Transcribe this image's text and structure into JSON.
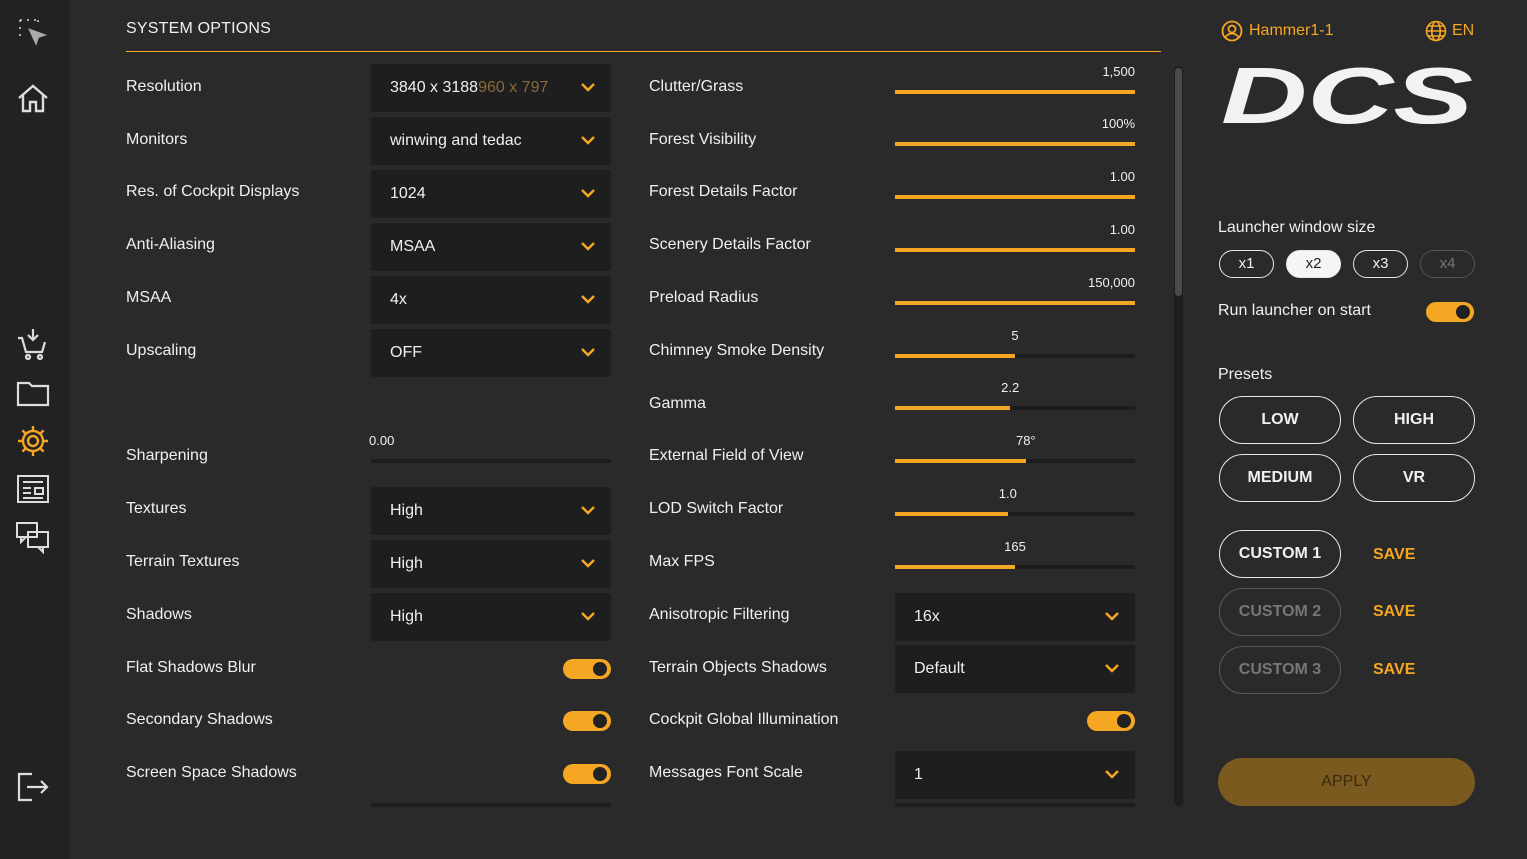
{
  "colors": {
    "accent": "#f5a623",
    "background": "#2a2a2a",
    "rail": "#222222",
    "field": "#1e1e1e"
  },
  "rail_icons": [
    "select-icon",
    "home-icon",
    "download-cart-icon",
    "folder-icon",
    "gear-icon",
    "news-icon",
    "chat-icon",
    "logout-icon"
  ],
  "header": {
    "title": "SYSTEM OPTIONS"
  },
  "left": {
    "resolution": {
      "label": "Resolution",
      "value": "3840 x 3188",
      "ghost": "960 x 797"
    },
    "monitors": {
      "label": "Monitors",
      "value": "winwing and tedac"
    },
    "cockpit_res": {
      "label": "Res. of Cockpit Displays",
      "value": "1024"
    },
    "anti_aliasing": {
      "label": "Anti-Aliasing",
      "value": "MSAA"
    },
    "msaa": {
      "label": "MSAA",
      "value": "4x"
    },
    "upscaling": {
      "label": "Upscaling",
      "value": "OFF"
    },
    "sharpening": {
      "label": "Sharpening",
      "value": "0.00",
      "fraction": 0
    },
    "textures": {
      "label": "Textures",
      "value": "High"
    },
    "terrain_textures": {
      "label": "Terrain Textures",
      "value": "High"
    },
    "shadows": {
      "label": "Shadows",
      "value": "High"
    },
    "flat_shadows_blur": {
      "label": "Flat Shadows Blur",
      "on": true
    },
    "secondary_shadows": {
      "label": "Secondary Shadows",
      "on": true
    },
    "screen_space_shadows": {
      "label": "Screen Space Shadows",
      "on": true
    }
  },
  "right": {
    "clutter": {
      "label": "Clutter/Grass",
      "value": "1,500",
      "fraction": 1.0
    },
    "forest_visibility": {
      "label": "Forest Visibility",
      "value": "100%",
      "fraction": 1.0
    },
    "forest_details": {
      "label": "Forest Details Factor",
      "value": "1.00",
      "fraction": 1.0
    },
    "scenery_details": {
      "label": "Scenery Details Factor",
      "value": "1.00",
      "fraction": 1.0
    },
    "preload_radius": {
      "label": "Preload Radius",
      "value": "150,000",
      "fraction": 1.0
    },
    "chimney_smoke": {
      "label": "Chimney Smoke Density",
      "value": "5",
      "fraction": 0.5
    },
    "gamma": {
      "label": "Gamma",
      "value": "2.2",
      "fraction": 0.48
    },
    "external_fov": {
      "label": "External Field of View",
      "value": "78°",
      "fraction": 0.545
    },
    "lod_switch": {
      "label": "LOD Switch Factor",
      "value": "1.0",
      "fraction": 0.47
    },
    "max_fps": {
      "label": "Max FPS",
      "value": "165",
      "fraction": 0.5
    },
    "anisotropic": {
      "label": "Anisotropic Filtering",
      "value": "16x"
    },
    "terrain_objects_shadows": {
      "label": "Terrain Objects Shadows",
      "value": "Default"
    },
    "cockpit_gi": {
      "label": "Cockpit Global Illumination",
      "on": true
    },
    "messages_font_scale": {
      "label": "Messages Font Scale",
      "value": "1"
    }
  },
  "user": {
    "name": "Hammer1-1",
    "language": "EN"
  },
  "logo_text": "DCS",
  "launcher": {
    "window_size_label": "Launcher window size",
    "sizes": [
      {
        "label": "x1",
        "state": "normal"
      },
      {
        "label": "x2",
        "state": "active"
      },
      {
        "label": "x3",
        "state": "normal"
      },
      {
        "label": "x4",
        "state": "disabled"
      }
    ],
    "run_on_start_label": "Run launcher on start",
    "run_on_start": true
  },
  "presets": {
    "label": "Presets",
    "low": "LOW",
    "high": "HIGH",
    "medium": "MEDIUM",
    "vr": "VR",
    "custom1": "CUSTOM 1",
    "custom2": "CUSTOM 2",
    "custom3": "CUSTOM 3",
    "save": "SAVE"
  },
  "apply_label": "APPLY"
}
